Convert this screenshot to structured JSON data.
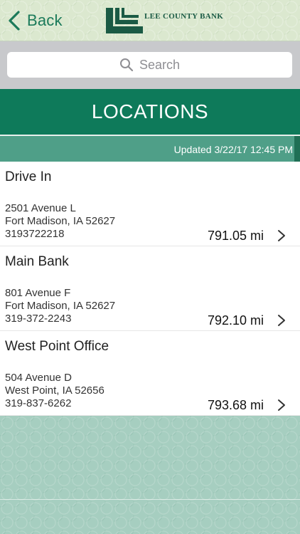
{
  "header": {
    "back_label": "Back",
    "logo_text": "Lee County Bank"
  },
  "search": {
    "placeholder": "Search"
  },
  "title": "LOCATIONS",
  "updated": "Updated 3/22/17 12:45 PM",
  "locations": [
    {
      "name": "Drive In",
      "address_line1": "2501 Avenue L",
      "address_line2": "Fort Madison, IA 52627",
      "phone": "3193722218",
      "distance": "791.05 mi"
    },
    {
      "name": "Main Bank",
      "address_line1": "801 Avenue F",
      "address_line2": "Fort Madison, IA 52627",
      "phone": "319-372-2243",
      "distance": "792.10 mi"
    },
    {
      "name": "West Point Office",
      "address_line1": "504 Avenue D",
      "address_line2": "West Point, IA 52656",
      "phone": "319-837-6262",
      "distance": "793.68 mi"
    }
  ],
  "colors": {
    "brand_green": "#0e7a5a",
    "updated_bar": "#4f9f88",
    "back_text": "#1b7a5a"
  },
  "icons": {
    "back": "chevron-left-icon",
    "search": "search-icon",
    "row_disclosure": "chevron-right-icon",
    "logo": "bank-logo"
  }
}
